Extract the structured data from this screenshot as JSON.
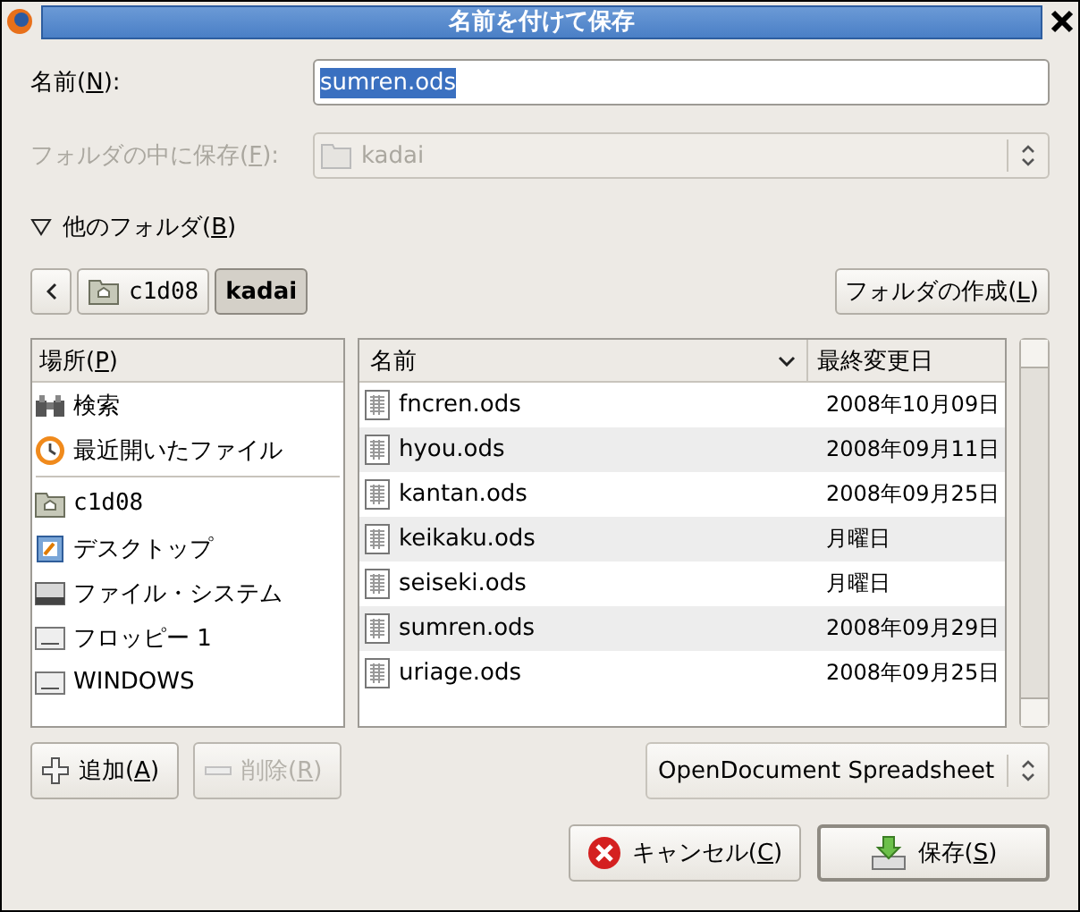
{
  "window": {
    "title": "名前を付けて保存"
  },
  "name_field": {
    "label": [
      "名前(",
      "N",
      "):"
    ],
    "value": "sumren.ods",
    "selected": true
  },
  "save_in": {
    "label": [
      "フォルダの中に保存(",
      "F",
      "):"
    ],
    "value": "kadai",
    "disabled": true
  },
  "expander": {
    "label": [
      "他のフォルダ(",
      "B",
      ")"
    ],
    "expanded": true
  },
  "path_bar": [
    {
      "label": "c1d08",
      "kind": "home",
      "selected": false
    },
    {
      "label": "kadai",
      "kind": "folder",
      "selected": true
    }
  ],
  "create_folder": [
    "フォルダの作成(",
    "L",
    ")"
  ],
  "places": {
    "header": [
      "場所(",
      "P",
      ")"
    ],
    "items": [
      {
        "label": "検索",
        "kind": "search"
      },
      {
        "label": "最近開いたファイル",
        "kind": "recent"
      },
      {
        "kind": "separator"
      },
      {
        "label": "c1d08",
        "kind": "home"
      },
      {
        "label": "デスクトップ",
        "kind": "desktop"
      },
      {
        "label": "ファイル・システム",
        "kind": "system"
      },
      {
        "label": "フロッピー 1",
        "kind": "drive"
      },
      {
        "label": "WINDOWS",
        "kind": "drive"
      }
    ]
  },
  "files": {
    "columns": [
      {
        "label": "名前",
        "sorted": true
      },
      {
        "label": "最終変更日",
        "sorted": false
      }
    ],
    "rows": [
      {
        "name": "fncren.ods",
        "modified": "2008年10月09日"
      },
      {
        "name": "hyou.ods",
        "modified": "2008年09月11日"
      },
      {
        "name": "kantan.ods",
        "modified": "2008年09月25日"
      },
      {
        "name": "keikaku.ods",
        "modified": "月曜日"
      },
      {
        "name": "seiseki.ods",
        "modified": "月曜日"
      },
      {
        "name": "sumren.ods",
        "modified": "2008年09月29日"
      },
      {
        "name": "uriage.ods",
        "modified": "2008年09月25日"
      }
    ]
  },
  "add_button": {
    "label": [
      "追加(",
      "A",
      ")"
    ],
    "disabled": false
  },
  "remove_button": {
    "label": [
      "削除(",
      "R",
      ")"
    ],
    "disabled": true
  },
  "file_type": {
    "value": "OpenDocument Spreadsheet"
  },
  "buttons": [
    {
      "label": [
        "キャンセル(",
        "C",
        ")"
      ],
      "kind": "cancel"
    },
    {
      "label": [
        "保存(",
        "S",
        ")"
      ],
      "kind": "save"
    }
  ]
}
